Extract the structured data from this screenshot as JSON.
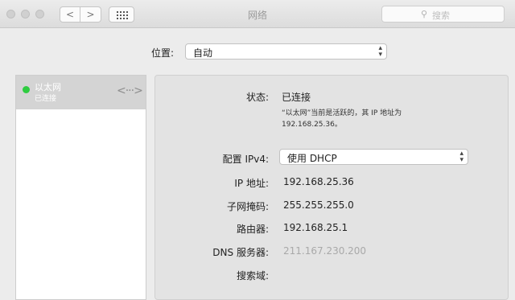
{
  "window": {
    "title": "网络"
  },
  "toolbar": {
    "back": "<",
    "forward": ">",
    "search_placeholder": "搜索"
  },
  "location": {
    "label": "位置:",
    "value": "自动"
  },
  "sidebar": {
    "items": [
      {
        "name": "以太网",
        "status": "已连接",
        "status_color": "#2ecc40"
      }
    ]
  },
  "details": {
    "status_label": "状态:",
    "status_value": "已连接",
    "status_note_1": "“以太网”当前是活跃的，其 IP 地址为",
    "status_note_2": "192.168.25.36。",
    "ipv4_label": "配置 IPv4:",
    "ipv4_value": "使用 DHCP",
    "ip_label": "IP 地址:",
    "ip_value": "192.168.25.36",
    "subnet_label": "子网掩码:",
    "subnet_value": "255.255.255.0",
    "router_label": "路由器:",
    "router_value": "192.168.25.1",
    "dns_label": "DNS 服务器:",
    "dns_value": "211.167.230.200",
    "search_domain_label": "搜索域:"
  }
}
